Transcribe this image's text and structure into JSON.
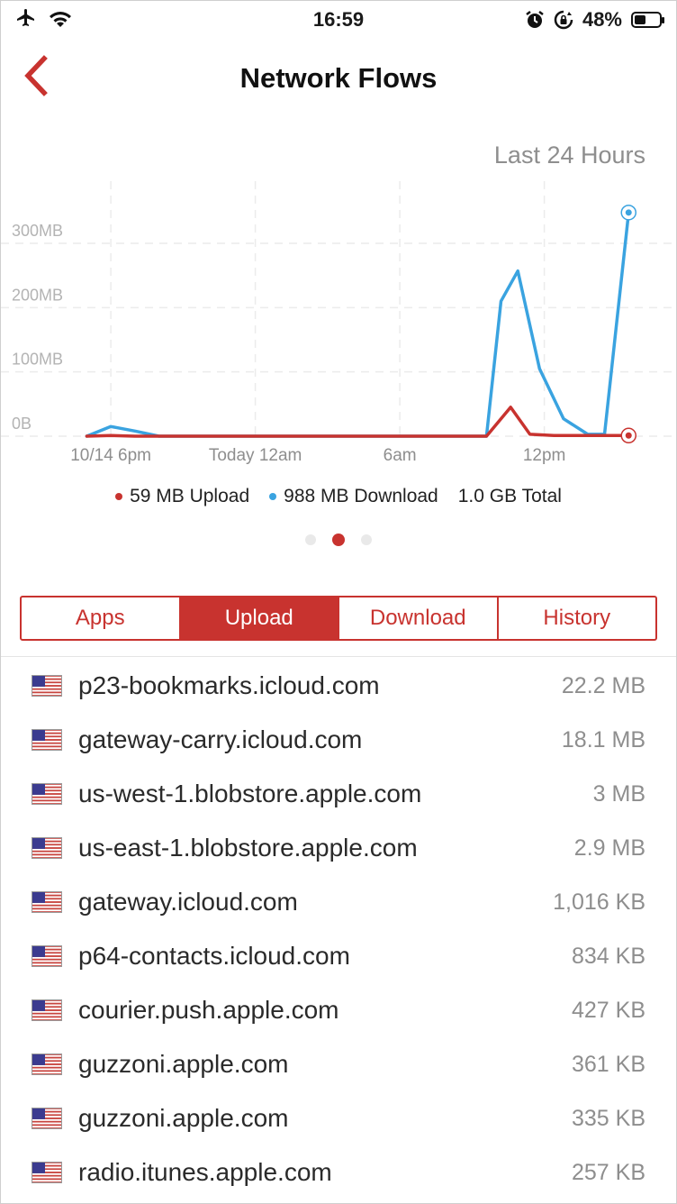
{
  "status_bar": {
    "time": "16:59",
    "battery_text": "48%",
    "battery_level": 0.48,
    "icons": [
      "airplane-icon",
      "wifi-icon",
      "alarm-icon",
      "rotation-lock-icon",
      "battery-icon"
    ]
  },
  "nav": {
    "title": "Network Flows",
    "back_icon": "chevron-left-icon"
  },
  "range_label": "Last 24 Hours",
  "colors": {
    "accent": "#c8332f",
    "upload": "#c8332f",
    "download": "#3aa3e0",
    "muted_text": "#8e8e8e"
  },
  "chart_data": {
    "type": "line",
    "x_ticks": [
      "10/14 6pm",
      "Today 12am",
      "6am",
      "12pm"
    ],
    "y_ticks": [
      "0B",
      "100MB",
      "200MB",
      "300MB"
    ],
    "ylim": [
      0,
      380
    ],
    "x_unit": "hours since 10/14 6pm",
    "xlim": [
      -1.5,
      22.5
    ],
    "series": [
      {
        "name": "Upload",
        "color": "#c8332f",
        "x": [
          -1.0,
          0.0,
          1.0,
          2.0,
          14.8,
          15.6,
          16.6,
          17.4,
          18.4,
          19.4,
          20.5,
          21.5
        ],
        "y": [
          0,
          1,
          0,
          0,
          0,
          0,
          45,
          3,
          1,
          1,
          1,
          1
        ]
      },
      {
        "name": "Download",
        "color": "#3aa3e0",
        "x": [
          -1.0,
          0.0,
          1.0,
          2.0,
          3.0,
          14.8,
          15.6,
          16.2,
          16.9,
          17.8,
          18.8,
          19.8,
          20.5,
          21.5
        ],
        "y": [
          0,
          15,
          8,
          0,
          0,
          0,
          0,
          210,
          257,
          105,
          27,
          3,
          3,
          348
        ]
      }
    ],
    "grid": true
  },
  "legend": {
    "upload": "59 MB Upload",
    "download": "988 MB Download",
    "total": "1.0 GB Total"
  },
  "pager": {
    "count": 3,
    "active": 1
  },
  "tabs": [
    {
      "label": "Apps",
      "selected": false
    },
    {
      "label": "Upload",
      "selected": true
    },
    {
      "label": "Download",
      "selected": false
    },
    {
      "label": "History",
      "selected": false
    }
  ],
  "flows": [
    {
      "host": "p23-bookmarks.icloud.com",
      "size": "22.2 MB",
      "flag": "us-flag-icon"
    },
    {
      "host": "gateway-carry.icloud.com",
      "size": "18.1 MB",
      "flag": "us-flag-icon"
    },
    {
      "host": "us-west-1.blobstore.apple.com",
      "size": "3 MB",
      "flag": "us-flag-icon"
    },
    {
      "host": "us-east-1.blobstore.apple.com",
      "size": "2.9 MB",
      "flag": "us-flag-icon"
    },
    {
      "host": "gateway.icloud.com",
      "size": "1,016 KB",
      "flag": "us-flag-icon"
    },
    {
      "host": "p64-contacts.icloud.com",
      "size": "834 KB",
      "flag": "us-flag-icon"
    },
    {
      "host": "courier.push.apple.com",
      "size": "427 KB",
      "flag": "us-flag-icon"
    },
    {
      "host": "guzzoni.apple.com",
      "size": "361 KB",
      "flag": "us-flag-icon"
    },
    {
      "host": "guzzoni.apple.com",
      "size": "335 KB",
      "flag": "us-flag-icon"
    },
    {
      "host": "radio.itunes.apple.com",
      "size": "257 KB",
      "flag": "us-flag-icon"
    }
  ]
}
